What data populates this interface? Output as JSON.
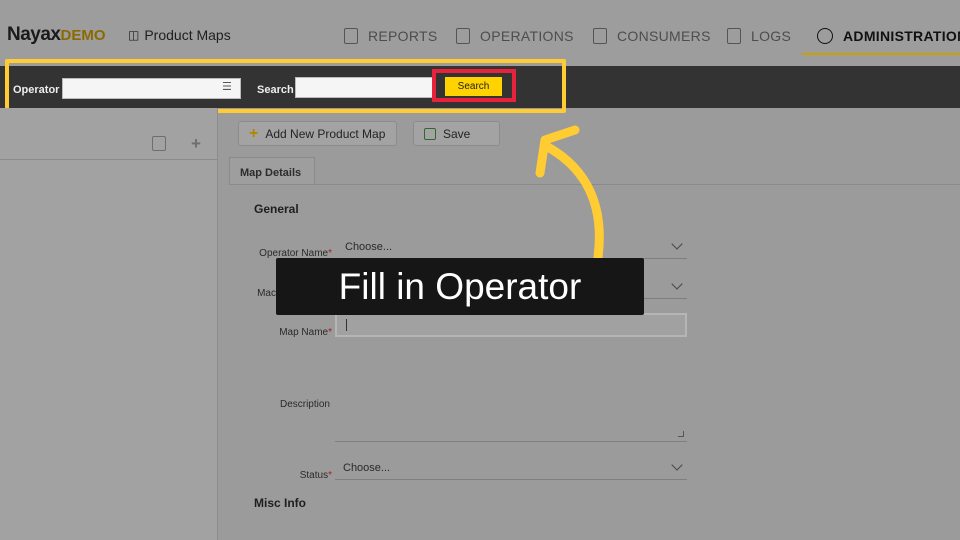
{
  "brand": {
    "name": "Nayax",
    "suffix": "DEMO"
  },
  "breadcrumb": {
    "label": "Product Maps"
  },
  "nav": [
    {
      "label": "REPORTS",
      "icon": "report-icon"
    },
    {
      "label": "OPERATIONS",
      "icon": "operations-icon"
    },
    {
      "label": "CONSUMERS",
      "icon": "consumers-icon"
    },
    {
      "label": "LOGS",
      "icon": "logs-icon"
    },
    {
      "label": "ADMINISTRATION",
      "icon": "admin-icon",
      "active": true
    }
  ],
  "searchbar": {
    "operator_label": "Operator",
    "operator_value": "",
    "search_label": "Search",
    "search_value": "",
    "search_button": "Search"
  },
  "toolbar": {
    "add_label": "Add New Product Map",
    "save_label": "Save"
  },
  "tabs": [
    {
      "label": "Map Details"
    }
  ],
  "form": {
    "general_heading": "General",
    "operator_name_label": "Operator Name",
    "operator_name_value": "Choose...",
    "machine_label": "Mac",
    "map_name_label": "Map Name",
    "map_name_value": "",
    "description_label": "Description",
    "status_label": "Status",
    "status_value": "Choose...",
    "misc_heading": "Misc Info"
  },
  "overlay": {
    "instruction": "Fill in Operator"
  },
  "colors": {
    "accent": "#ffd200",
    "highlight": "#ffcc33",
    "focus_box": "#e8223a",
    "bar": "#333333"
  }
}
